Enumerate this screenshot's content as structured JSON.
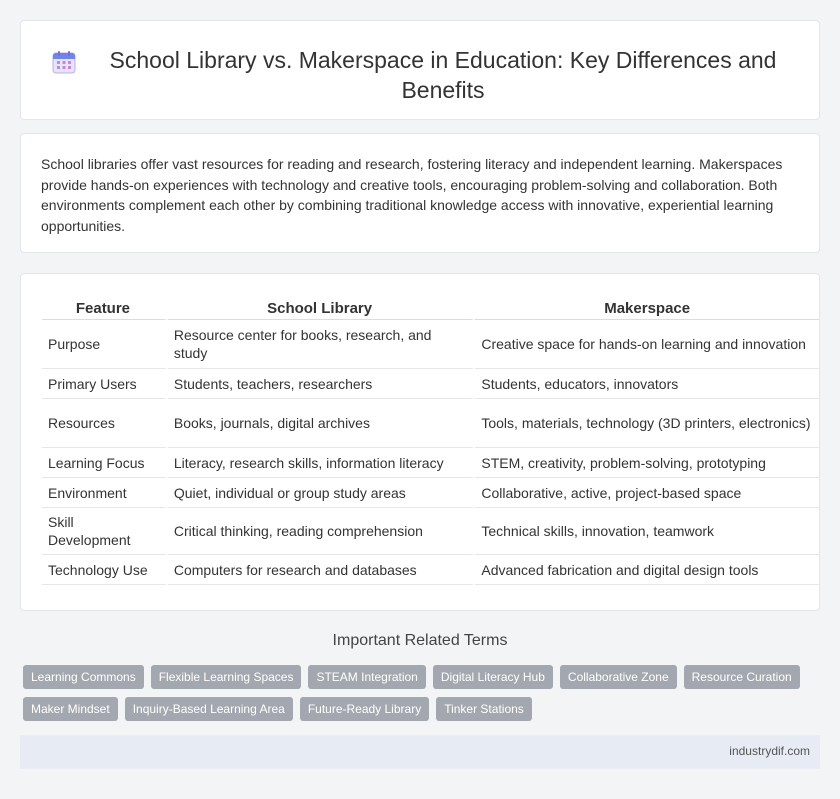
{
  "header": {
    "title": "School Library vs. Makerspace in Education: Key Differences and Benefits",
    "icon": "calendar-icon"
  },
  "intro": {
    "text": "School libraries offer vast resources for reading and research, fostering literacy and independent learning. Makerspaces provide hands-on experiences with technology and creative tools, encouraging problem-solving and collaboration. Both environments complement each other by combining traditional knowledge access with innovative, experiential learning opportunities."
  },
  "table": {
    "headers": [
      "Feature",
      "School Library",
      "Makerspace"
    ],
    "rows": [
      [
        "Purpose",
        "Resource center for books, research, and study",
        "Creative space for hands-on learning and innovation"
      ],
      [
        "Primary Users",
        "Students, teachers, researchers",
        "Students, educators, innovators"
      ],
      [
        "Resources",
        "Books, journals, digital archives",
        "Tools, materials, technology (3D printers, electronics)"
      ],
      [
        "Learning Focus",
        "Literacy, research skills, information literacy",
        "STEM, creativity, problem-solving, prototyping"
      ],
      [
        "Environment",
        "Quiet, individual or group study areas",
        "Collaborative, active, project-based space"
      ],
      [
        "Skill Development",
        "Critical thinking, reading comprehension",
        "Technical skills, innovation, teamwork"
      ],
      [
        "Technology Use",
        "Computers for research and databases",
        "Advanced fabrication and digital design tools"
      ]
    ]
  },
  "related": {
    "title": "Important Related Terms",
    "tags": [
      "Learning Commons",
      "Flexible Learning Spaces",
      "STEAM Integration",
      "Digital Literacy Hub",
      "Collaborative Zone",
      "Resource Curation",
      "Maker Mindset",
      "Inquiry-Based Learning Area",
      "Future-Ready Library",
      "Tinker Stations"
    ]
  },
  "footer": {
    "site": "industrydif.com"
  }
}
